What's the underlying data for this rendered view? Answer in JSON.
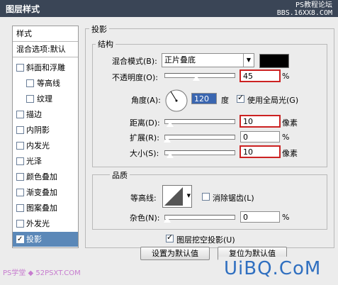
{
  "window": {
    "title": "图层样式",
    "watermark_top_1": "PS教程论坛",
    "watermark_top_2": "BBS.16XX8.COM"
  },
  "sidebar": {
    "header": "样式",
    "blend": "混合选项:默认",
    "items": [
      {
        "label": "斜面和浮雕",
        "checked": false
      },
      {
        "label": "等高线",
        "checked": false
      },
      {
        "label": "纹理",
        "checked": false
      },
      {
        "label": "描边",
        "checked": false
      },
      {
        "label": "内阴影",
        "checked": false
      },
      {
        "label": "内发光",
        "checked": false
      },
      {
        "label": "光泽",
        "checked": false
      },
      {
        "label": "颜色叠加",
        "checked": false
      },
      {
        "label": "渐变叠加",
        "checked": false
      },
      {
        "label": "图案叠加",
        "checked": false
      },
      {
        "label": "外发光",
        "checked": false
      },
      {
        "label": "投影",
        "checked": true
      }
    ]
  },
  "panel": {
    "group_title": "投影",
    "structure": {
      "title": "结构",
      "blend_mode_label": "混合模式(B):",
      "blend_mode_value": "正片叠底",
      "shadow_color": "#000000",
      "opacity_label": "不透明度(O):",
      "opacity_value": "45",
      "opacity_unit": "%",
      "angle_label": "角度(A):",
      "angle_value": "120",
      "angle_unit": "度",
      "global_light_label": "使用全局光(G)",
      "global_light_checked": true,
      "distance_label": "距离(D):",
      "distance_value": "10",
      "distance_unit": "像素",
      "spread_label": "扩展(R):",
      "spread_value": "0",
      "spread_unit": "%",
      "size_label": "大小(S):",
      "size_value": "10",
      "size_unit": "像素"
    },
    "quality": {
      "title": "品质",
      "contour_label": "等高线:",
      "anti_alias_label": "消除锯齿(L)",
      "anti_alias_checked": false,
      "noise_label": "杂色(N):",
      "noise_value": "0",
      "noise_unit": "%"
    },
    "knockout_label": "图层挖空投影(U)",
    "knockout_checked": true,
    "set_default_label": "设置为默认值",
    "reset_default_label": "复位为默认值"
  },
  "footer": {
    "watermark_left": "PS学堂 ◆ 52PSXT.COM",
    "logo": "UiBQ.CoM"
  },
  "slider_levels": {
    "opacity": 0.45,
    "distance": 0.04,
    "spread": 0.0,
    "size": 0.04,
    "noise": 0.0
  },
  "colors": {
    "titlebar": "#3a4556",
    "selected_item": "#5b88b8",
    "highlight_box": "#cc2222",
    "logo": "#2f6fc0"
  }
}
